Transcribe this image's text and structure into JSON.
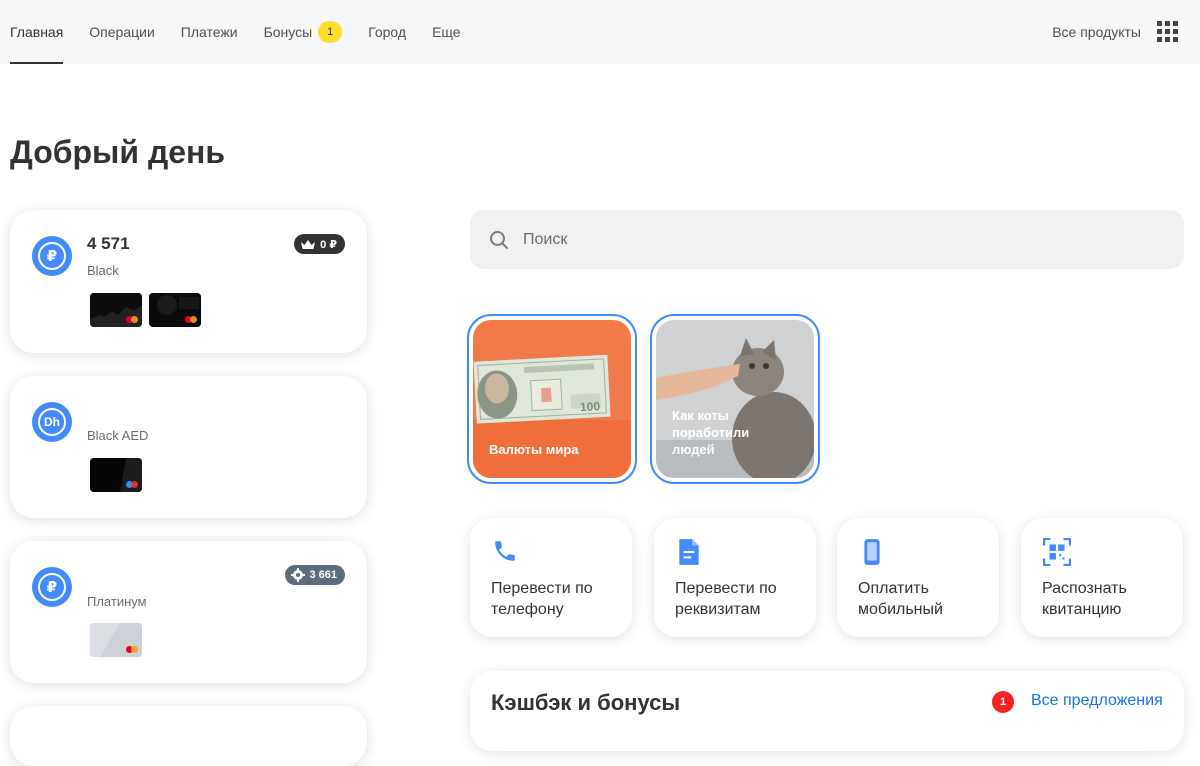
{
  "nav": {
    "tabs": [
      {
        "label": "Главная"
      },
      {
        "label": "Операции"
      },
      {
        "label": "Платежи"
      },
      {
        "label": "Бонусы",
        "badge": "1"
      },
      {
        "label": "Город"
      },
      {
        "label": "Еще"
      }
    ],
    "all_products": "Все продукты"
  },
  "greeting": "Добрый день",
  "accounts": [
    {
      "balance": "4 571",
      "name": "Black",
      "currency_icon": "ruble-icon",
      "currency_symbol": "₽",
      "pill": "0 ₽",
      "pill_icon": "crown-icon",
      "pill_color": "#333333"
    },
    {
      "balance": "",
      "name": "Black AED",
      "currency_icon": "dirham-icon",
      "currency_symbol": "Dh"
    },
    {
      "balance": "",
      "name": "Платинум",
      "currency_icon": "ruble-icon",
      "currency_symbol": "₽",
      "pill": "3 661",
      "pill_icon": "gear-icon",
      "pill_color": "#5e6b7d"
    }
  ],
  "search": {
    "placeholder": "Поиск"
  },
  "stories": [
    {
      "caption": "Валюты мира"
    },
    {
      "caption": "Как коты поработили людей"
    }
  ],
  "quick_actions": [
    {
      "label": "Перевести по телефону",
      "icon": "phone-icon"
    },
    {
      "label": "Перевести по реквизитам",
      "icon": "document-icon"
    },
    {
      "label": "Оплатить мобильный",
      "icon": "mobile-icon"
    },
    {
      "label": "Распознать квитанцию",
      "icon": "qr-scan-icon"
    }
  ],
  "cashback": {
    "title": "Кэшбэк и бонусы",
    "badge": "1",
    "link": "Все предложения"
  },
  "colors": {
    "accent": "#428bf9",
    "badge_yellow": "#ffdd2d",
    "link": "#1771e6",
    "alert": "#f52222"
  }
}
